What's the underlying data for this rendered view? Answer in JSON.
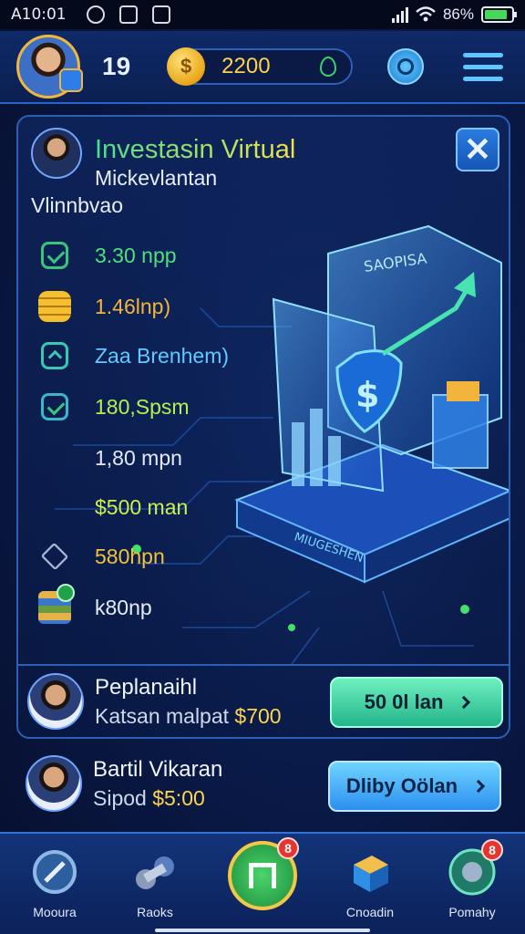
{
  "status_bar": {
    "time": "A10:01",
    "battery": "86%"
  },
  "header": {
    "level": "19",
    "coins": "2200",
    "coin_symbol": "$"
  },
  "card": {
    "title": "Investasin Virtual",
    "subtitle_line1": "Mickevlantan",
    "subtitle_line2": "Vlinnbvao",
    "close_label": "✕",
    "illustration_label_top": "SAOPISA",
    "illustration_label_base": "MIUGESHEN",
    "stats": [
      {
        "icon": "check-icon",
        "text": "3.30 npp",
        "color": "#4fe07a"
      },
      {
        "icon": "coins-icon",
        "text": "1.46lnp)",
        "color": "#f2b43a"
      },
      {
        "icon": "chevron-up-icon",
        "text": "Zaa Brenhem)",
        "color": "#62c9ff"
      },
      {
        "icon": "check-icon",
        "text": "180,Spsm",
        "color": "#b6f050"
      },
      {
        "icon": "",
        "text": "1,80 mpn",
        "color": "#e3e9f6"
      },
      {
        "icon": "",
        "text": "$500 man",
        "color": "#cdf04c"
      },
      {
        "icon": "house-icon",
        "text": "580hpn",
        "color": "#f0c23c"
      },
      {
        "icon": "books-icon",
        "text": "k80np",
        "color": "#e6ecf8"
      }
    ],
    "offer1": {
      "title": "Peplanaihl",
      "subtitle_prefix": "Katsan malpat",
      "amount": "$700",
      "button": "50 0l lan"
    }
  },
  "offer2": {
    "title": "Bartil Vikaran",
    "subtitle_prefix": "Sipod",
    "amount": "$5:00",
    "button": "Dliby Oölan"
  },
  "nav": {
    "items": [
      {
        "label": "Mooura",
        "badge": ""
      },
      {
        "label": "Raoks",
        "badge": ""
      },
      {
        "label": "",
        "badge": "8"
      },
      {
        "label": "Cnoadin",
        "badge": ""
      },
      {
        "label": "Pomahy",
        "badge": "8"
      }
    ]
  },
  "colors": {
    "accent": "#2d5fb2",
    "coin": "#ffd14d",
    "green_button": "#24b58a",
    "blue_button": "#2c8ff0"
  }
}
